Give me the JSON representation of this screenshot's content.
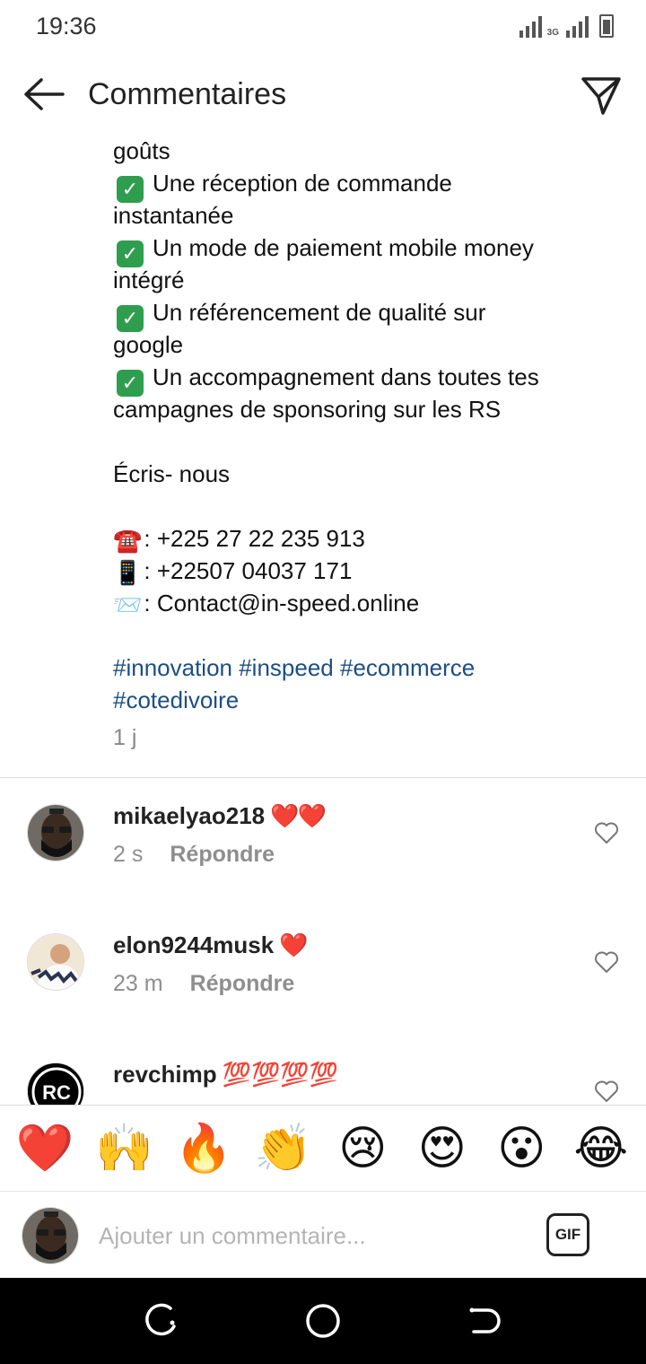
{
  "status_bar": {
    "time": "19:36",
    "network": "3G"
  },
  "header": {
    "title": "Commentaires",
    "back_icon": "arrow-left-icon",
    "send_icon": "paper-plane-icon"
  },
  "caption": {
    "lines": [
      "goûts",
      "Une réception de commande",
      "instantanée",
      "Un mode de paiement mobile money",
      "intégré",
      "Un référencement de qualité sur",
      "google",
      "Un accompagnement dans toutes tes",
      "campagnes de sponsoring sur les RS",
      "Écris- nous",
      ": +225 27 22 235 913",
      ": +22507 04037 171",
      ": Contact@in-speed.online",
      "#innovation #inspeed #ecommerce",
      "#cotedivoire"
    ],
    "check_icon": "✓",
    "phone_icon": "☎️",
    "mobile_icon": "📱",
    "mail_icon": "📨",
    "time_ago": "1 j"
  },
  "comments": [
    {
      "username": "mikaelyao218",
      "emoji": "❤️❤️",
      "time": "2 s",
      "reply_label": "Répondre"
    },
    {
      "username": "elon9244musk",
      "emoji": "❤️",
      "time": "23 m",
      "reply_label": "Répondre"
    },
    {
      "username": "revchimp",
      "emoji": "💯💯💯💯",
      "time": "",
      "reply_label": ""
    }
  ],
  "emoji_bar": [
    "❤️",
    "🙌",
    "🔥",
    "👏",
    "😢",
    "😍",
    "😮",
    "😂"
  ],
  "input": {
    "placeholder": "Ajouter un commentaire...",
    "gif_label": "GIF"
  },
  "colors": {
    "hashtag": "#1b4e85",
    "heart": "#e0242e",
    "meta": "#8e8e8e"
  }
}
